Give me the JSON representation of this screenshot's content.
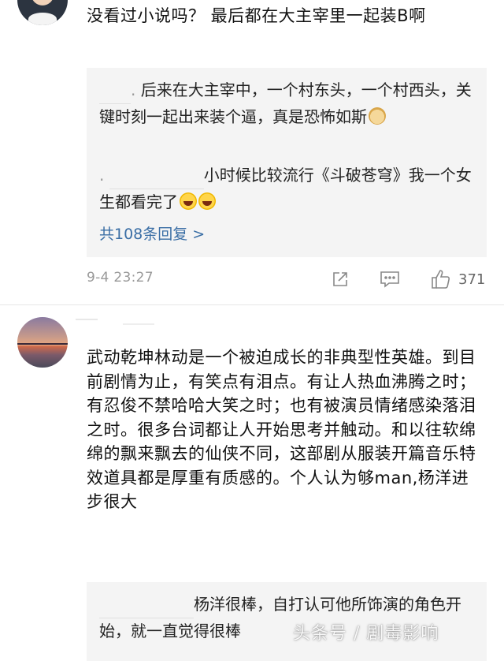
{
  "comments": [
    {
      "text": "没看过小说吗？ 最后都在大主宰里一起装B啊",
      "replies": [
        {
          "user": "　　",
          "text": "后来在大主宰中，一个村东头，一个村西头，关键时刻一起出来装个逼，真是恐怖如斯",
          "emoji": "doge-icon"
        },
        {
          "user": "　　　　　　",
          "text": "小时候比较流行《斗破苍穹》我一个女生都看完了",
          "emoji": "laugh-cry-icon"
        }
      ],
      "more_replies_label": "共108条回复 >",
      "timestamp": "9-4 23:27",
      "like_count": "371"
    },
    {
      "text": "武动乾坤林动是一个被迫成长的非典型性英雄。到目前剧情为止，有笑点有泪点。有让人热血沸腾之时；有忍俊不禁哈哈大笑之时；也有被演员情绪感染落泪之时。很多台词都让人开始思考并触动。和以往软绵绵的飘来飘去的仙侠不同，这部剧从服装开篇音乐特效道具都是厚重有质感的。个人认为够man,杨洋进步很大",
      "replies": [
        {
          "user": "　　　　　　",
          "text": "杨洋很棒，自打认可他所饰演的角色开始，就一直觉得很棒"
        }
      ]
    }
  ],
  "watermark": "头条号 / 剧毒影响",
  "colors": {
    "link": "#3a6ea5",
    "reply_bg": "#f4f4f4",
    "meta": "#999999"
  }
}
